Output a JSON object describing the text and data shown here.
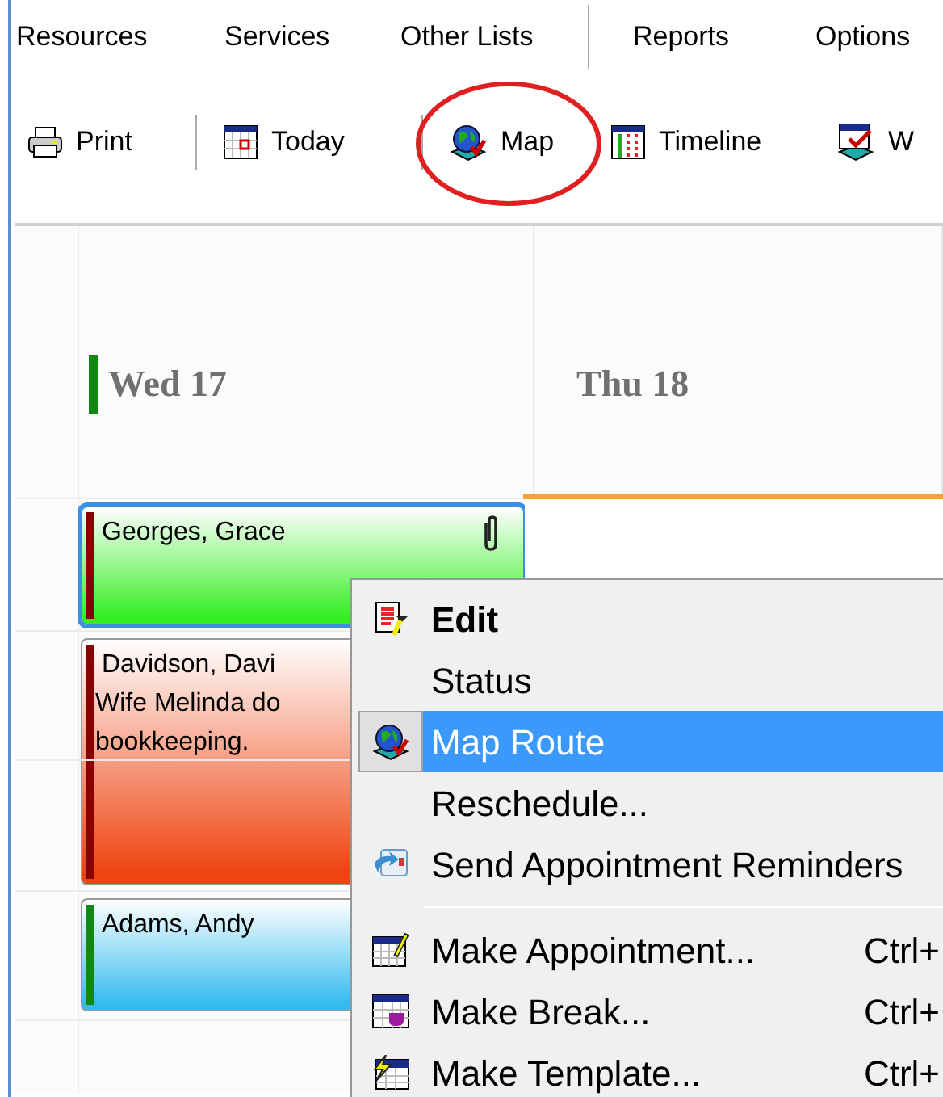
{
  "menu_bar": [
    {
      "label": "Resources",
      "divider_after": false
    },
    {
      "label": "Services",
      "divider_after": false
    },
    {
      "label": "Other Lists",
      "divider_after": true
    },
    {
      "label": "Reports",
      "divider_after": false
    },
    {
      "label": "Options",
      "divider_after": false
    }
  ],
  "toolbar": [
    {
      "kind": "print",
      "label": "Print",
      "divider_after": true
    },
    {
      "kind": "today",
      "label": "Today",
      "divider_after": true
    },
    {
      "kind": "map",
      "label": "Map",
      "divider_after": false
    },
    {
      "kind": "timeline",
      "label": "Timeline",
      "divider_after": false
    },
    {
      "kind": "week",
      "label": "W",
      "divider_after": false
    }
  ],
  "days": [
    {
      "label": "Wed 17",
      "today": true
    },
    {
      "label": "Thu 18",
      "today": false
    }
  ],
  "appointments": [
    {
      "name": "Georges, Grace",
      "color": "#33ee22",
      "bar": {
        "color": "#880000"
      },
      "selected": true,
      "attachment": true
    },
    {
      "name": "Davidson, Davi",
      "note": "Wife Melinda do\nbookkeeping.",
      "color": "#ee4411",
      "bar": {
        "color": "#880000"
      },
      "selected": false,
      "attachment": false
    },
    {
      "name": "Adams, Andy",
      "color": "#33bbee",
      "bar": {
        "color": "#118811"
      },
      "selected": false,
      "attachment": false
    }
  ],
  "context_menu": [
    {
      "kind": "edit",
      "label": "Edit",
      "default": true,
      "selected": false
    },
    {
      "kind": "none",
      "label": "Status",
      "default": false,
      "selected": false
    },
    {
      "kind": "map",
      "label": "Map Route",
      "default": false,
      "selected": true
    },
    {
      "kind": "none",
      "label": "Reschedule...",
      "default": false,
      "selected": false
    },
    {
      "kind": "send",
      "label": "Send Appointment Reminders",
      "default": false,
      "selected": false
    },
    {
      "kind": "separator"
    },
    {
      "kind": "appointment",
      "label": "Make Appointment...",
      "shortcut": "Ctrl+",
      "default": false,
      "selected": false
    },
    {
      "kind": "break",
      "label": "Make Break...",
      "shortcut": "Ctrl+",
      "default": false,
      "selected": false
    },
    {
      "kind": "template",
      "label": "Make Template...",
      "shortcut": "Ctrl+",
      "default": false,
      "selected": false
    }
  ]
}
